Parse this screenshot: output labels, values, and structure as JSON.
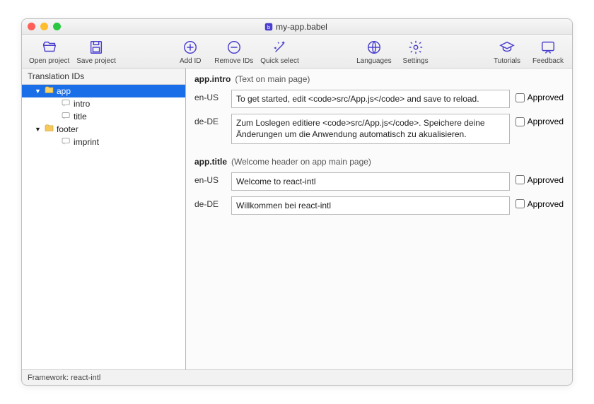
{
  "window": {
    "title": "my-app.babel"
  },
  "toolbar": {
    "open": "Open project",
    "save": "Save project",
    "add": "Add ID",
    "remove": "Remove IDs",
    "quick": "Quick select",
    "languages": "Languages",
    "settings": "Settings",
    "tutorials": "Tutorials",
    "feedback": "Feedback"
  },
  "sidebar": {
    "header": "Translation IDs",
    "tree": [
      {
        "type": "folder",
        "label": "app",
        "selected": true,
        "expanded": true,
        "depth": 1
      },
      {
        "type": "leaf",
        "label": "intro",
        "depth": 2
      },
      {
        "type": "leaf",
        "label": "title",
        "depth": 2
      },
      {
        "type": "folder",
        "label": "footer",
        "expanded": true,
        "depth": 1
      },
      {
        "type": "leaf",
        "label": "imprint",
        "depth": 2
      }
    ]
  },
  "main": {
    "sections": [
      {
        "id": "app.intro",
        "desc": "(Text on main page)",
        "rows": [
          {
            "locale": "en-US",
            "text": "To get started, edit <code>src/App.js</code> and save to reload.",
            "approved_label": "Approved"
          },
          {
            "locale": "de-DE",
            "text": "Zum Loslegen editiere <code>src/App.js</code>. Speichere deine Änderungen um die Anwendung automatisch zu akualisieren.",
            "approved_label": "Approved"
          }
        ]
      },
      {
        "id": "app.title",
        "desc": "(Welcome header on app main page)",
        "rows": [
          {
            "locale": "en-US",
            "text": "Welcome to react-intl",
            "approved_label": "Approved"
          },
          {
            "locale": "de-DE",
            "text": "Willkommen bei react-intl",
            "approved_label": "Approved"
          }
        ]
      }
    ]
  },
  "status": {
    "text": "Framework: react-intl"
  }
}
